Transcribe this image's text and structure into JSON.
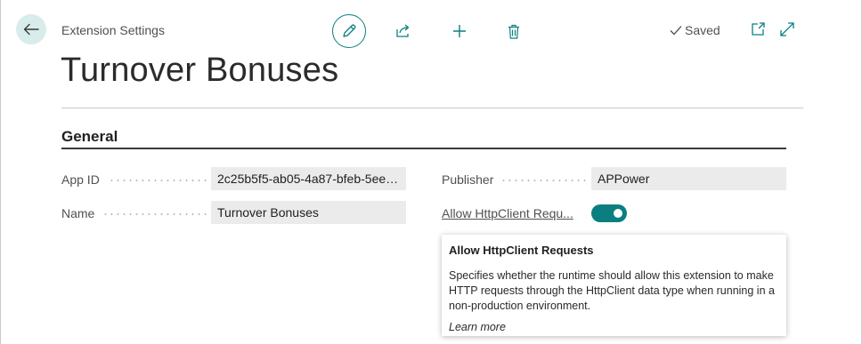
{
  "header": {
    "breadcrumb": "Extension Settings",
    "status": "Saved"
  },
  "toolbar": {
    "edit": "pencil-icon",
    "share": "share-icon",
    "new": "plus-icon",
    "delete": "trash-icon",
    "popout": "open-in-new-window-icon",
    "expand": "expand-icon"
  },
  "page": {
    "title": "Turnover Bonuses"
  },
  "section": {
    "title": "General"
  },
  "fields": {
    "app_id": {
      "label": "App ID",
      "value": "2c25b5f5-ab05-4a87-bfeb-5eed..."
    },
    "name": {
      "label": "Name",
      "value": "Turnover Bonuses"
    },
    "publisher": {
      "label": "Publisher",
      "value": "APPower"
    },
    "allow_http": {
      "label": "Allow HttpClient Requ...",
      "enabled": true
    }
  },
  "tooltip": {
    "title": "Allow HttpClient Requests",
    "body": "Specifies whether the runtime should allow this extension to make HTTP requests through the HttpClient data type when running in a non-production environment.",
    "link": "Learn more"
  },
  "colors": {
    "accent": "#0b7f7f",
    "back_button_bg": "#d8eceb",
    "field_bg": "#ebebeb"
  }
}
